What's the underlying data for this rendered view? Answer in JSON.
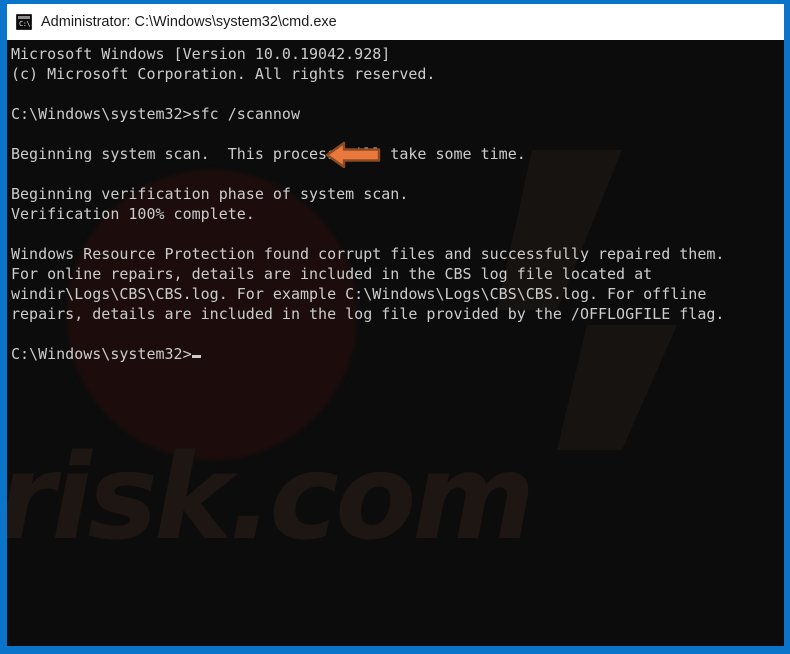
{
  "window": {
    "title": "Administrator: C:\\Windows\\system32\\cmd.exe",
    "icon_name": "cmd-console-icon",
    "icon_glyph": "C:\\.",
    "frame_color": "#0a74ca",
    "titlebar_bg": "#ffffff",
    "titlebar_text_color": "#1b1b1b"
  },
  "console": {
    "background": "#0c0c0c",
    "foreground": "#cccccc",
    "lines": [
      "Microsoft Windows [Version 10.0.19042.928]",
      "(c) Microsoft Corporation. All rights reserved.",
      "",
      "C:\\Windows\\system32>sfc /scannow",
      "",
      "Beginning system scan.  This process will take some time.",
      "",
      "Beginning verification phase of system scan.",
      "Verification 100% complete.",
      "",
      "Windows Resource Protection found corrupt files and successfully repaired them.",
      "For online repairs, details are included in the CBS log file located at",
      "windir\\Logs\\CBS\\CBS.log. For example C:\\Windows\\Logs\\CBS\\CBS.log. For offline",
      "repairs, details are included in the log file provided by the /OFFLOGFILE flag.",
      "",
      "C:\\Windows\\system32>"
    ],
    "prompt_line": "C:\\Windows\\system32>",
    "command": "sfc /scannow",
    "cursor": "block-underscore"
  },
  "annotation": {
    "arrow_name": "left-pointing-arrow",
    "direction": "left",
    "fill_color": "#e8783b",
    "stroke_color": "#8a4a22",
    "points_at": "sfc /scannow"
  },
  "watermark": {
    "text": "risk.com",
    "color": "#1d1612"
  }
}
